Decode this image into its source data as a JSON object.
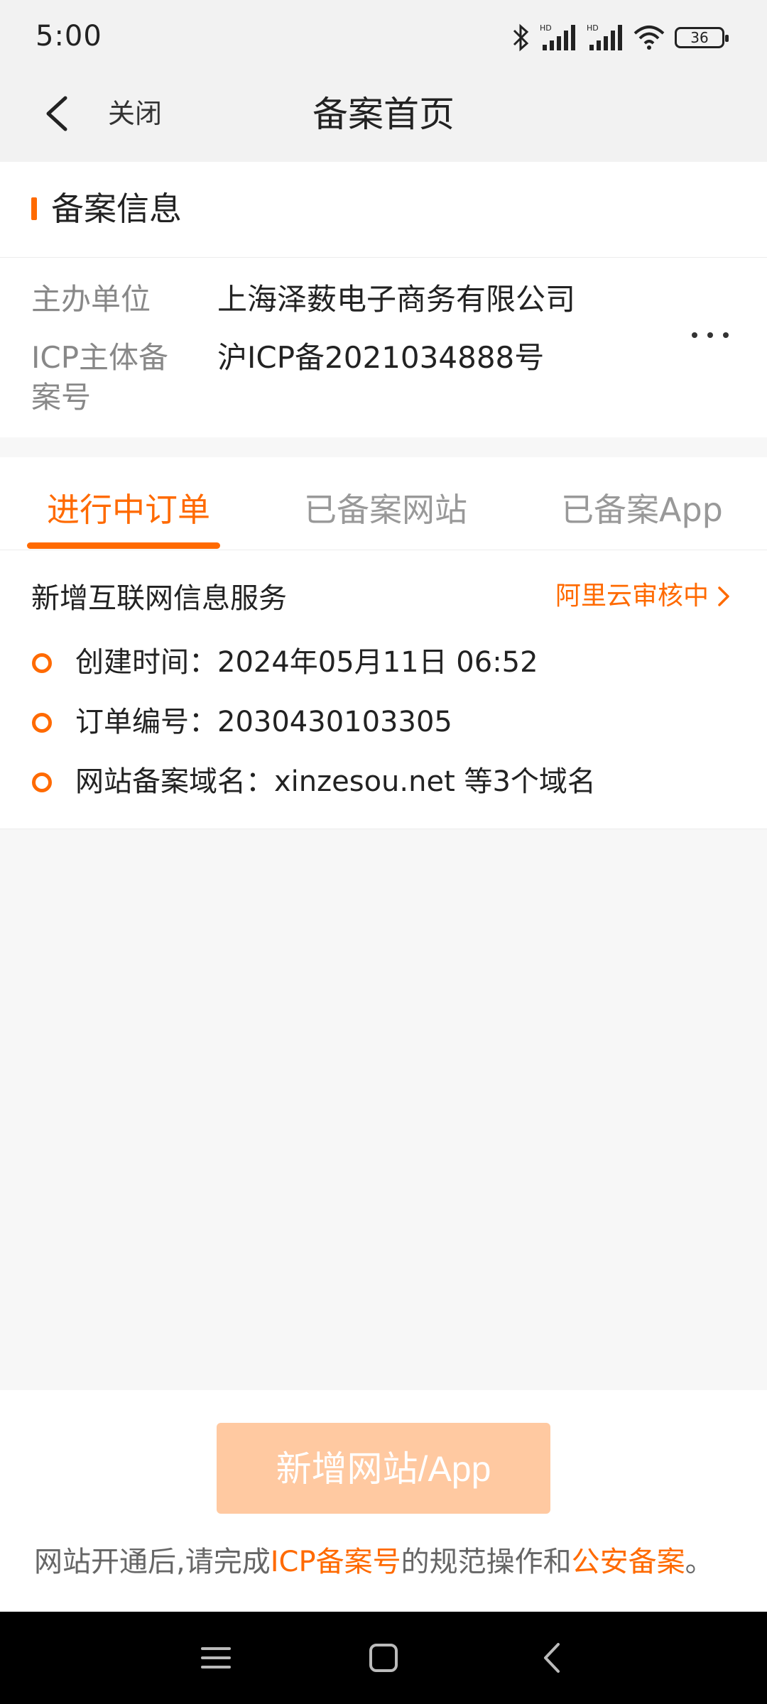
{
  "status_bar": {
    "time": "5:00",
    "battery": "36",
    "icons": [
      "bluetooth-icon",
      "signal-hd-icon",
      "signal-hd-icon",
      "wifi-icon",
      "battery-icon"
    ]
  },
  "nav": {
    "close_label": "关闭",
    "title": "备案首页"
  },
  "info": {
    "section_title": "备案信息",
    "org_label": "主办单位",
    "org_value": "上海泽薮电子商务有限公司",
    "icp_label": "ICP主体备案号",
    "icp_value": "沪ICP备2021034888号"
  },
  "tabs": [
    {
      "label": "进行中订单",
      "active": true
    },
    {
      "label": "已备案网站",
      "active": false
    },
    {
      "label": "已备案App",
      "active": false
    }
  ],
  "order": {
    "title": "新增互联网信息服务",
    "status": "阿里云审核中",
    "rows": [
      "创建时间：2024年05月11日 06:52",
      "订单编号：2030430103305",
      "网站备案域名：xinzesou.net 等3个域名"
    ]
  },
  "bottom": {
    "add_button": "新增网站/App",
    "notice_prefix": "网站开通后,请完成",
    "notice_link1": "ICP备案号",
    "notice_middle": "的规范操作和",
    "notice_link2": "公安备案",
    "notice_suffix": "。"
  },
  "colors": {
    "accent": "#ff6a00",
    "button_disabled": "#ffc9a1"
  }
}
